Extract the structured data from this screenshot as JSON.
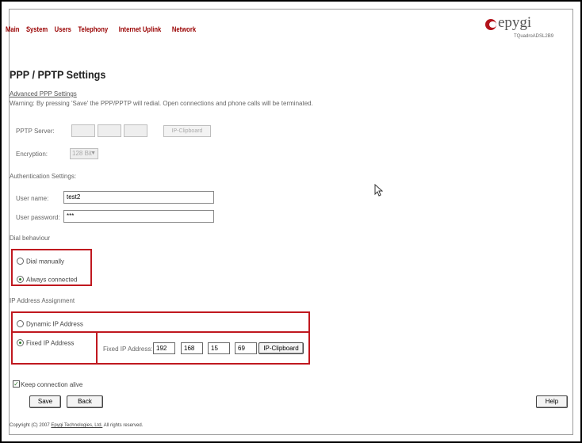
{
  "nav": {
    "items": [
      "Main",
      "System",
      "Users",
      "Telephony",
      "Internet Uplink",
      "Network"
    ]
  },
  "brand": {
    "logo_text": "epygi",
    "model": "TQuadroADSL2B9",
    "logo_color": "#b3131b"
  },
  "page": {
    "title": "PPP / PPTP Settings",
    "advanced_link": "Advanced PPP Settings",
    "warning": "Warning: By pressing 'Save' the PPP/PPTP will redial. Open connections and phone calls will be terminated."
  },
  "pptp": {
    "server_label": "PPTP Server:",
    "clipboard_label": "IP-Clipboard",
    "encryption_label": "Encryption:",
    "encryption_value": "128 Bit"
  },
  "auth": {
    "heading": "Authentication Settings:",
    "username_label": "User name:",
    "username_value": "test2",
    "password_label": "User password:",
    "password_value": "***"
  },
  "dial": {
    "heading": "Dial behaviour",
    "manual_label": "Dial manually",
    "always_label": "Always connected",
    "selected": "always"
  },
  "ip": {
    "heading": "IP Address Assignment",
    "dynamic_label": "Dynamic IP Address",
    "fixed_label": "Fixed IP Address",
    "selected": "fixed",
    "fixed_ip_label": "Fixed IP Address:",
    "octets": [
      "192",
      "168",
      "15",
      "69"
    ],
    "clipboard_label": "IP-Clipboard"
  },
  "keepalive": {
    "label": "Keep connection alive",
    "checked": true
  },
  "buttons": {
    "save": "Save",
    "back": "Back",
    "help": "Help"
  },
  "footer": {
    "prefix": "Copyright (C) 2007",
    "company": "Epygi Technologies, Ltd.",
    "suffix": "All rights reserved."
  },
  "colors": {
    "nav": "#990000",
    "highlight_box": "#c0181f"
  }
}
